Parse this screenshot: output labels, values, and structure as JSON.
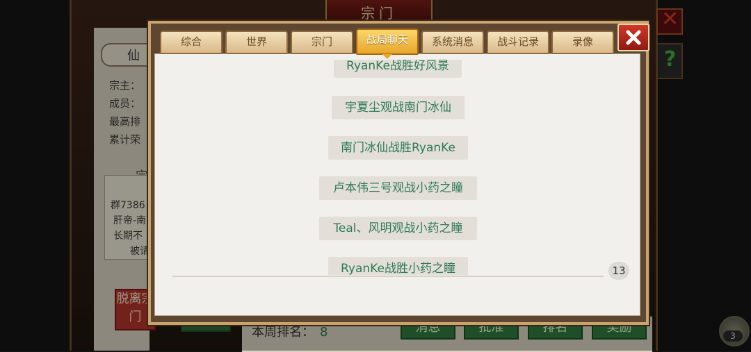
{
  "background": {
    "window_title": "宗门",
    "left_tab_label": "仙",
    "info_lines": [
      "宗主：",
      "成员：",
      "最高排",
      "累计荣"
    ],
    "sect_header": "宗",
    "sect_lines": [
      "群7386",
      "肝帝-南",
      "长期不",
      "被请"
    ],
    "leave_button_label": "脱离宗门",
    "weekly_rank_label": "本周排名：",
    "weekly_rank_value": "8",
    "bottom_buttons": [
      "消息",
      "批准",
      "排名",
      "奖励"
    ],
    "close_icon_glyph": "✕",
    "help_icon_glyph": "?",
    "avatar_count": "3"
  },
  "dialog": {
    "tabs": [
      {
        "label": "综合",
        "active": false
      },
      {
        "label": "世界",
        "active": false
      },
      {
        "label": "宗门",
        "active": false
      },
      {
        "label": "战局聊天",
        "active": true
      },
      {
        "label": "系统消息",
        "active": false
      },
      {
        "label": "战斗记录",
        "active": false
      },
      {
        "label": "录像",
        "active": false
      }
    ],
    "messages": [
      "RyanKe战胜好风景",
      "宇夏尘观战南门冰仙",
      "南门冰仙战胜RyanKe",
      "卢本伟三号观战小药之瞳",
      "Teal、风明观战小药之瞳",
      "RyanKe战胜小药之瞳"
    ],
    "message_count": "13"
  },
  "colors": {
    "accent_green": "#2e7a56",
    "active_tab": "#e8a62a",
    "close_red": "#c62a1e"
  }
}
